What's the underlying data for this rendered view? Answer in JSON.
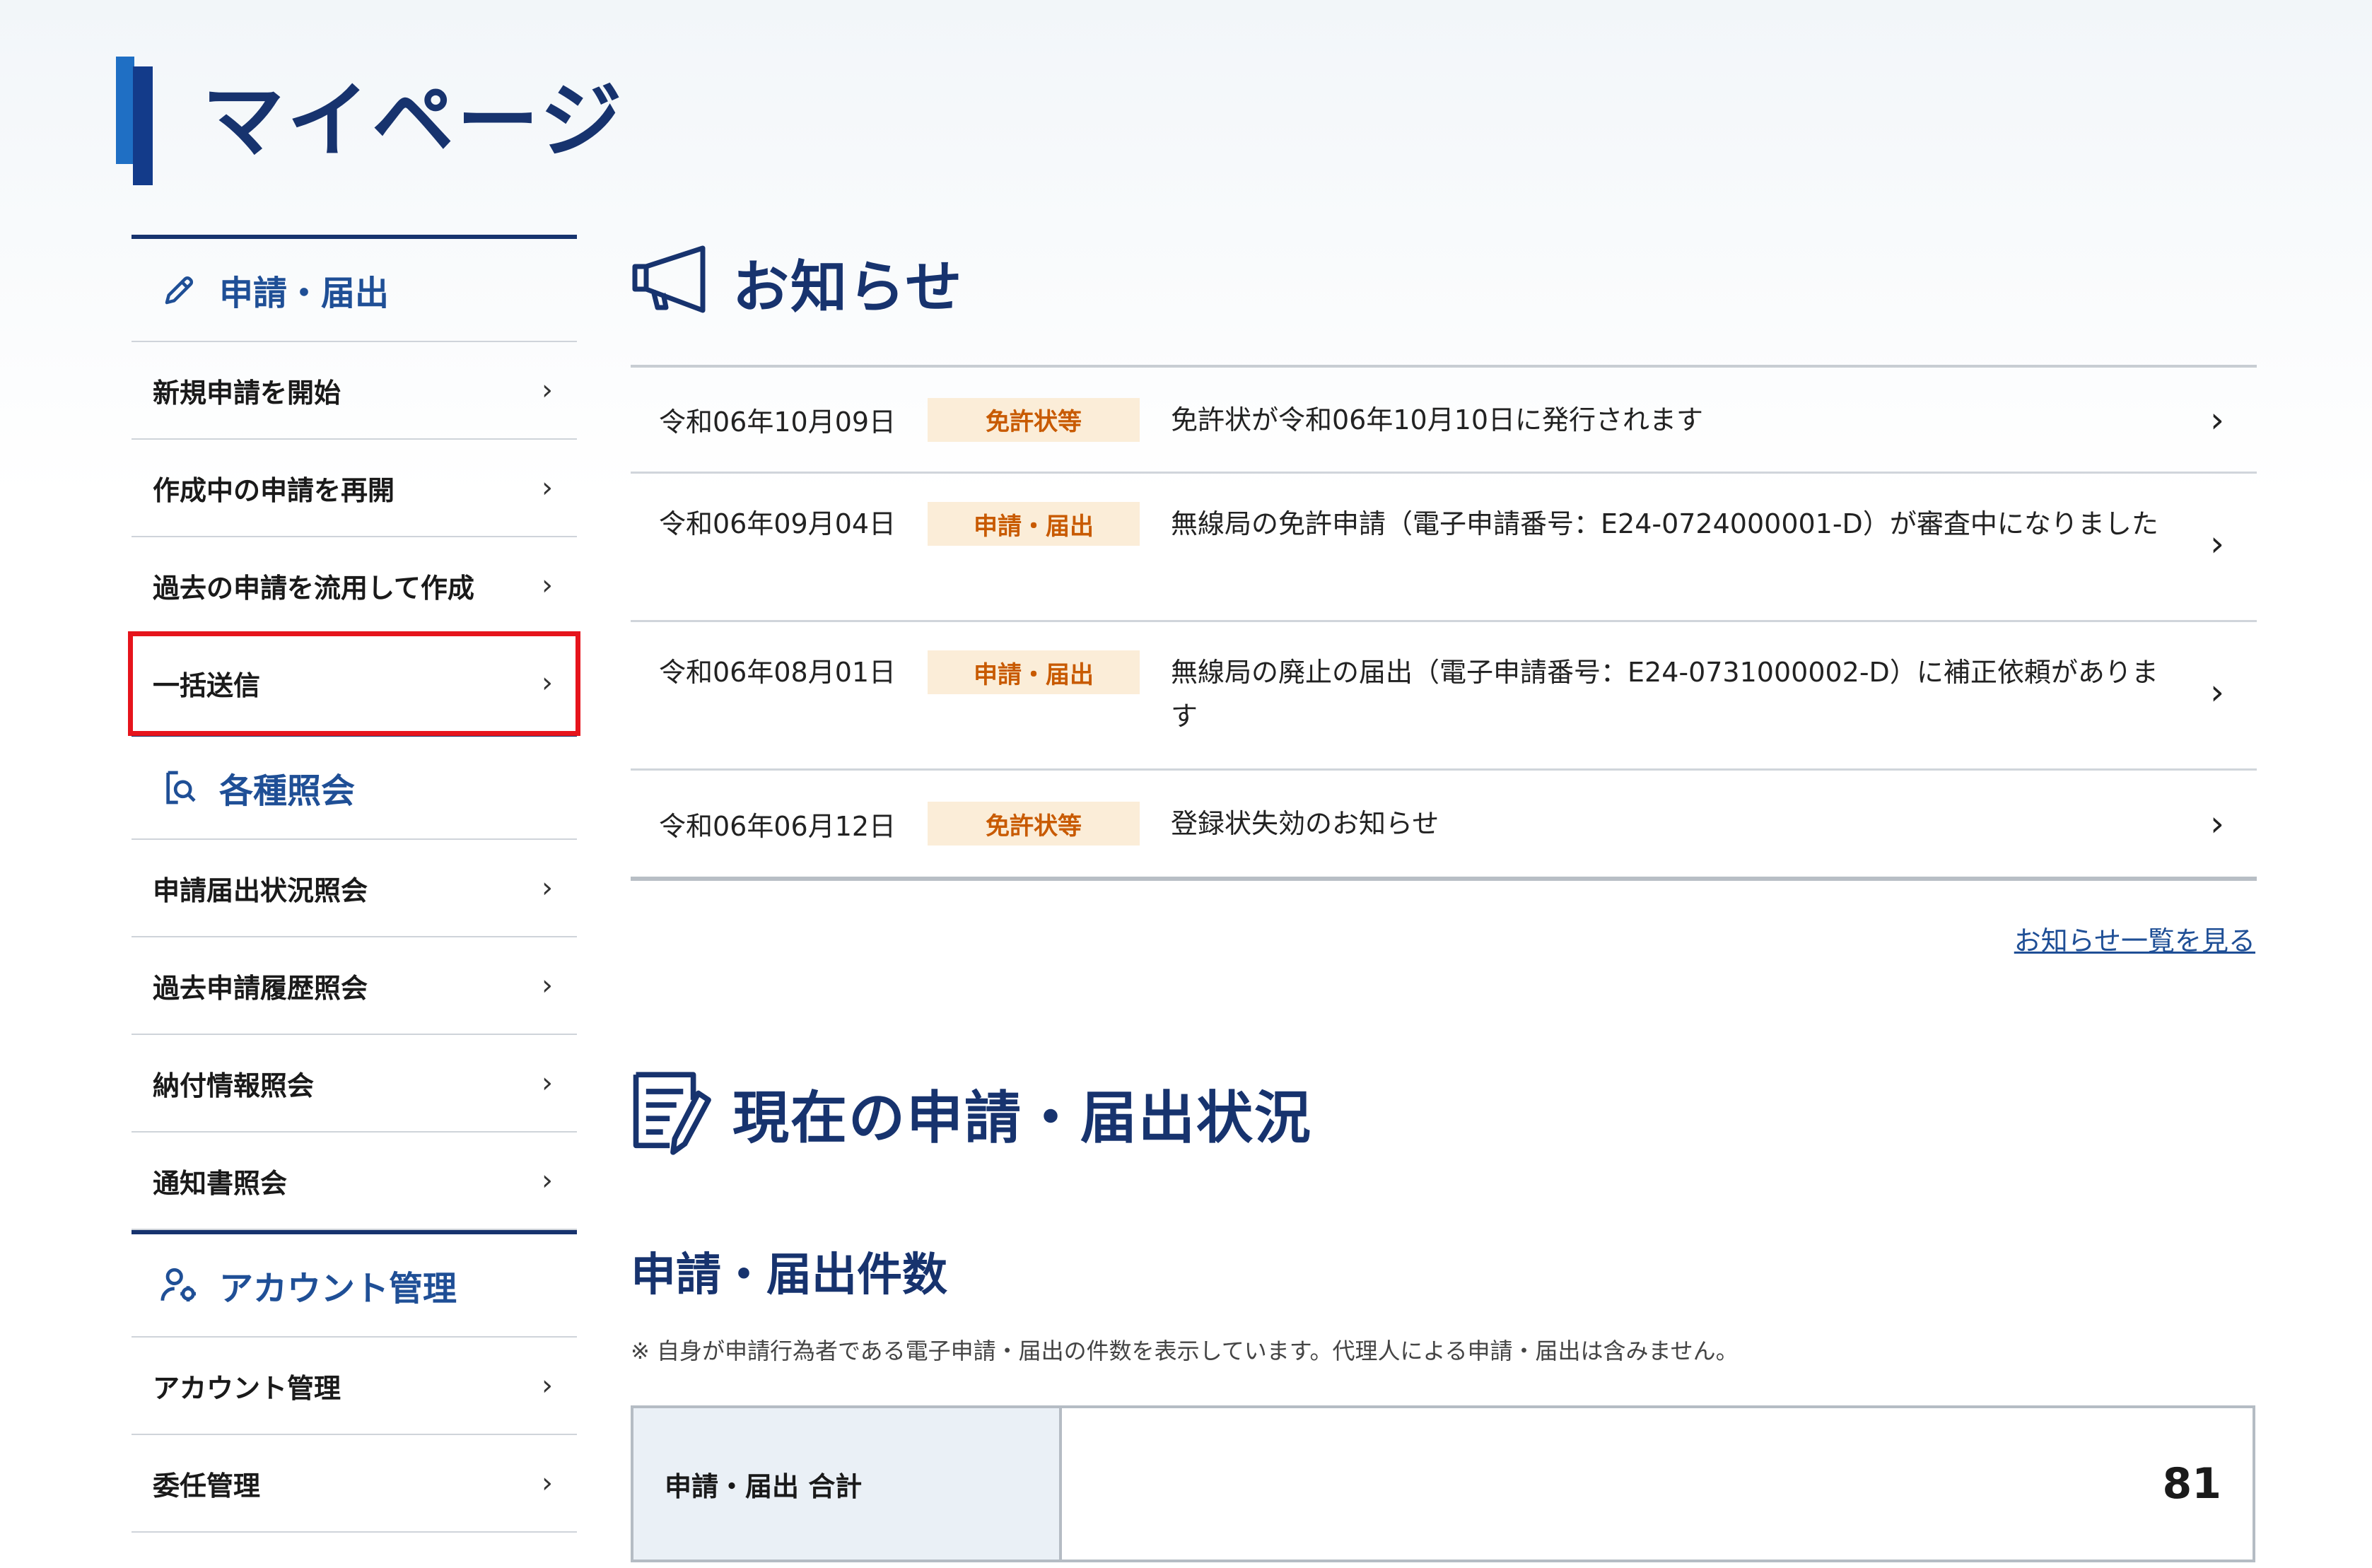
{
  "page": {
    "title": "マイページ"
  },
  "sidebar": {
    "sections": [
      {
        "label": "申請・届出",
        "icon": "pencil-icon",
        "items": [
          {
            "label": "新規申請を開始"
          },
          {
            "label": "作成中の申請を再開"
          },
          {
            "label": "過去の申請を流用して作成"
          },
          {
            "label": "一括送信",
            "highlighted": true
          }
        ]
      },
      {
        "label": "各種照会",
        "icon": "search-document-icon",
        "items": [
          {
            "label": "申請届出状況照会"
          },
          {
            "label": "過去申請履歴照会"
          },
          {
            "label": "納付情報照会"
          },
          {
            "label": "通知書照会"
          }
        ]
      },
      {
        "label": "アカウント管理",
        "icon": "user-settings-icon",
        "items": [
          {
            "label": "アカウント管理"
          },
          {
            "label": "委任管理"
          }
        ]
      }
    ]
  },
  "notices": {
    "title": "お知らせ",
    "icon": "megaphone-icon",
    "items": [
      {
        "date": "令和06年10月09日",
        "category": "免許状等",
        "text": "免許状が令和06年10月10日に発行されます"
      },
      {
        "date": "令和06年09月04日",
        "category": "申請・届出",
        "text": "無線局の免許申請（電子申請番号：E24-0724000001-D）が審査中になりました"
      },
      {
        "date": "令和06年08月01日",
        "category": "申請・届出",
        "text": "無線局の廃止の届出（電子申請番号：E24-0731000002-D）に補正依頼があります"
      },
      {
        "date": "令和06年06月12日",
        "category": "免許状等",
        "text": "登録状失効のお知らせ"
      }
    ],
    "more_link": "お知らせ一覧を見る"
  },
  "status": {
    "title": "現在の申請・届出状況",
    "icon": "document-list-icon",
    "subtitle": "申請・届出件数",
    "note": "※ 自身が申請行為者である電子申請・届出の件数を表示しています。代理人による申請・届出は含みません。",
    "total_label": "申請・届出 合計",
    "total_value": "81"
  },
  "colors": {
    "primary": "#17336e",
    "accent": "#1f6fc4",
    "badge_bg": "#fbedd8",
    "badge_text": "#c85a00",
    "highlight": "#e6141c"
  }
}
